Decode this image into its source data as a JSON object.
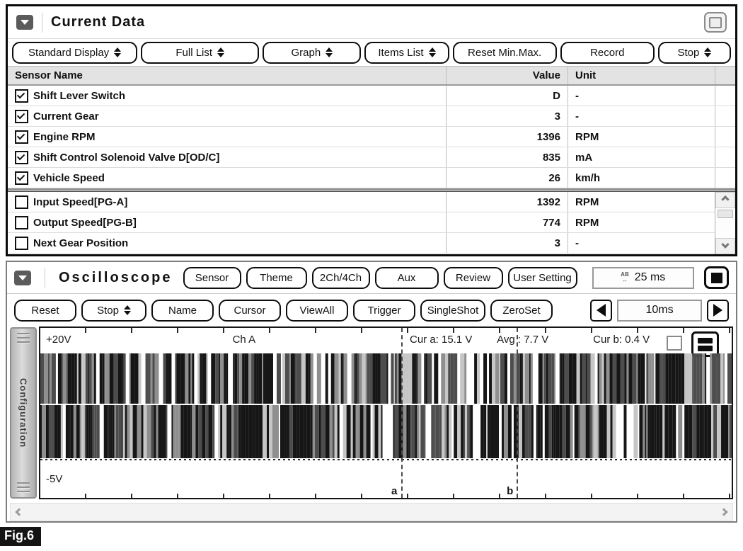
{
  "colors": {
    "panel1_border": "#0a0a0a",
    "panel2_border": "#7c7c7c",
    "header_bg": "#e3e3e3",
    "config_tab_bg": "#c9c9c9",
    "figure_bg": "#141414",
    "accent_text": "#111111"
  },
  "current_data": {
    "title": "Current Data",
    "toolbar": [
      {
        "label": "Standard Display",
        "spinner": true
      },
      {
        "label": "Full List",
        "spinner": true
      },
      {
        "label": "Graph",
        "spinner": true
      },
      {
        "label": "Items List",
        "spinner": true
      },
      {
        "label": "Reset Min.Max.",
        "spinner": false
      },
      {
        "label": "Record",
        "spinner": false
      },
      {
        "label": "Stop",
        "spinner": true
      }
    ],
    "table": {
      "headers": {
        "name": "Sensor Name",
        "value": "Value",
        "unit": "Unit"
      },
      "rows": [
        {
          "checked": true,
          "name": "Shift Lever Switch",
          "value": "D",
          "unit": "-"
        },
        {
          "checked": true,
          "name": "Current Gear",
          "value": "3",
          "unit": "-"
        },
        {
          "checked": true,
          "name": "Engine RPM",
          "value": "1396",
          "unit": "RPM"
        },
        {
          "checked": true,
          "name": "Shift Control Solenoid Valve D[OD/C]",
          "value": "835",
          "unit": "mA"
        },
        {
          "checked": true,
          "name": "Vehicle Speed",
          "value": "26",
          "unit": "km/h"
        }
      ],
      "extra_rows": [
        {
          "checked": false,
          "name": "Input Speed[PG-A]",
          "value": "1392",
          "unit": "RPM"
        },
        {
          "checked": false,
          "name": "Output Speed[PG-B]",
          "value": "774",
          "unit": "RPM"
        },
        {
          "checked": false,
          "name": "Next Gear Position",
          "value": "3",
          "unit": "-"
        }
      ]
    }
  },
  "oscilloscope": {
    "title": "Oscilloscope",
    "top_buttons": [
      "Sensor",
      "Theme",
      "2Ch/4Ch",
      "Aux",
      "Review",
      "User Setting"
    ],
    "time_display": {
      "icon_top": "AB",
      "icon_bottom": "↔",
      "value": "25 ms"
    },
    "bottom_buttons": [
      {
        "label": "Reset",
        "spinner": false
      },
      {
        "label": "Stop",
        "spinner": true
      },
      {
        "label": "Name",
        "spinner": false
      },
      {
        "label": "Cursor",
        "spinner": false
      },
      {
        "label": "ViewAll",
        "spinner": false
      },
      {
        "label": "Trigger",
        "spinner": false
      },
      {
        "label": "SingleShot",
        "spinner": false
      },
      {
        "label": "ZeroSet",
        "spinner": false
      }
    ],
    "timebase": {
      "value": "10ms"
    },
    "config_tab_label": "Configuration",
    "scope": {
      "v_max": "+20V",
      "v_min": "-5V",
      "channel": "Ch A",
      "cur_a": "Cur a: 15.1 V",
      "avg": "Avg : 7.7 V",
      "cur_b": "Cur b: 0.4 V",
      "marker_a": "a",
      "marker_b": "b",
      "cursor_a_pos_pct": 52.2,
      "cursor_b_pos_pct": 68.9,
      "channel_pos_pct": 27.8
    }
  },
  "figure_label": "Fig.6"
}
